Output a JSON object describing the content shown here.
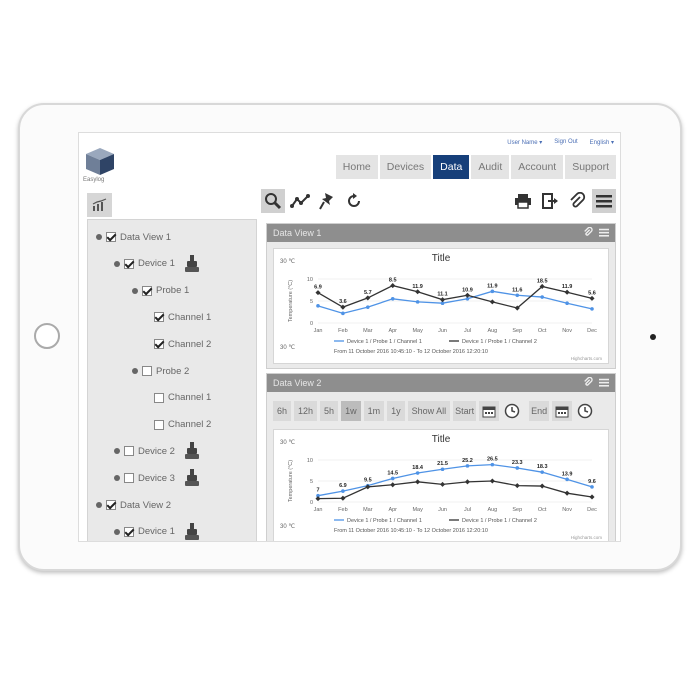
{
  "header": {
    "logo_text": "Easylog",
    "user_links": [
      "User Name ▾",
      "Sign Out",
      "English ▾"
    ]
  },
  "nav": {
    "tabs": [
      "Home",
      "Devices",
      "Data",
      "Audit",
      "Account",
      "Support"
    ],
    "active": "Data"
  },
  "toolbar": {
    "left_icons": [
      "zoom-icon",
      "line-chart-icon",
      "pin-icon",
      "refresh-icon"
    ],
    "right_icons": [
      "print-icon",
      "export-icon",
      "attachment-icon",
      "menu-icon"
    ]
  },
  "tree": {
    "items": [
      {
        "label": "Data View 1",
        "checked": true,
        "level": 0
      },
      {
        "label": "Device 1",
        "checked": true,
        "level": 1,
        "probe": true
      },
      {
        "label": "Probe 1",
        "checked": true,
        "level": 2
      },
      {
        "label": "Channel 1",
        "checked": true,
        "level": 3
      },
      {
        "label": "Channel 2",
        "checked": true,
        "level": 3
      },
      {
        "label": "Probe 2",
        "checked": false,
        "level": 2
      },
      {
        "label": "Channel 1",
        "checked": false,
        "level": 3
      },
      {
        "label": "Channel 2",
        "checked": false,
        "level": 3
      },
      {
        "label": "Device 2",
        "checked": false,
        "level": 1,
        "probe": true
      },
      {
        "label": "Device 3",
        "checked": false,
        "level": 1,
        "probe": true
      },
      {
        "label": "Data View 2",
        "checked": true,
        "level": 0
      },
      {
        "label": "Device 1",
        "checked": true,
        "level": 1,
        "probe": true
      }
    ]
  },
  "panels": [
    {
      "title": "Data View 1",
      "chart_title": "Title",
      "footer": "From 11 October 2016 10:45:10 - To 12 October 2016 12:20:10",
      "legend": [
        "Device 1 / Probe 1 / Channel 1",
        "Device 1 / Probe 1 / Channel 2"
      ],
      "ylabel": "Temperature (°C)",
      "credit": "Highcharts.com",
      "corner_labels": [
        "30 ℃",
        "30 ℃"
      ]
    },
    {
      "title": "Data View 2",
      "chart_title": "Title",
      "footer": "From 11 October 2016 10:45:10 - To 12 October 2016 12:20:10",
      "legend": [
        "Device 1 / Probe 1 / Channel 1",
        "Device 1 / Probe 1 / Channel 2"
      ],
      "ylabel": "Temperature (°C)",
      "credit": "Highcharts.com",
      "corner_labels": [
        "30 ℃",
        "30 ℃"
      ]
    }
  ],
  "range_buttons": [
    "6h",
    "12h",
    "5h",
    "1w",
    "1m",
    "1y",
    "Show All"
  ],
  "range_selected": "1w",
  "start_label": "Start",
  "end_label": "End",
  "colors": {
    "nav_active": "#163f7a",
    "series1": "#4f93e6",
    "series2": "#333333"
  },
  "chart_data": [
    {
      "type": "line",
      "title": "Title",
      "categories": [
        "Jan",
        "Feb",
        "Mar",
        "Apr",
        "May",
        "Jun",
        "Jul",
        "Aug",
        "Sep",
        "Oct",
        "Nov",
        "Dec"
      ],
      "ylabel": "Temperature (°C)",
      "ylim": [
        0,
        10
      ],
      "yticks": [
        0,
        5,
        10
      ],
      "series": [
        {
          "name": "Device 1 / Probe 1 / Channel 1",
          "values": [
            3.9,
            2.2,
            3.6,
            5.5,
            4.8,
            4.5,
            5.5,
            7.2,
            6.3,
            5.9,
            4.5,
            3.2
          ]
        },
        {
          "name": "Device 1 / Probe 1 / Channel 2",
          "values": [
            6.9,
            3.6,
            5.7,
            8.5,
            7.1,
            5.3,
            6.3,
            4.8,
            3.4,
            8.3,
            7.0,
            5.6
          ]
        }
      ],
      "data_labels": [
        "6.9",
        "3.6",
        "5.7",
        "8.5",
        "11.9",
        "11.1",
        "10.9",
        "11.9",
        "11.6",
        "18.5",
        "11.9",
        "5.6"
      ]
    },
    {
      "type": "line",
      "title": "Title",
      "categories": [
        "Jan",
        "Feb",
        "Mar",
        "Apr",
        "May",
        "Jun",
        "Jul",
        "Aug",
        "Sep",
        "Oct",
        "Nov",
        "Dec"
      ],
      "ylabel": "Temperature (°C)",
      "ylim": [
        0,
        10
      ],
      "yticks": [
        0,
        5,
        10
      ],
      "series": [
        {
          "name": "Device 1 / Probe 1 / Channel 1",
          "values": [
            1.5,
            2.6,
            3.9,
            5.6,
            6.9,
            7.8,
            8.6,
            8.9,
            8.1,
            7.1,
            5.4,
            3.6
          ]
        },
        {
          "name": "Device 1 / Probe 1 / Channel 2",
          "values": [
            0.8,
            0.9,
            3.6,
            4.1,
            4.8,
            4.2,
            4.8,
            5.0,
            3.9,
            3.8,
            2.1,
            1.2
          ]
        }
      ],
      "data_labels": [
        "7",
        "6.9",
        "9.5",
        "14.5",
        "18.4",
        "21.5",
        "25.2",
        "26.5",
        "23.3",
        "18.3",
        "13.9",
        "9.6"
      ]
    }
  ]
}
